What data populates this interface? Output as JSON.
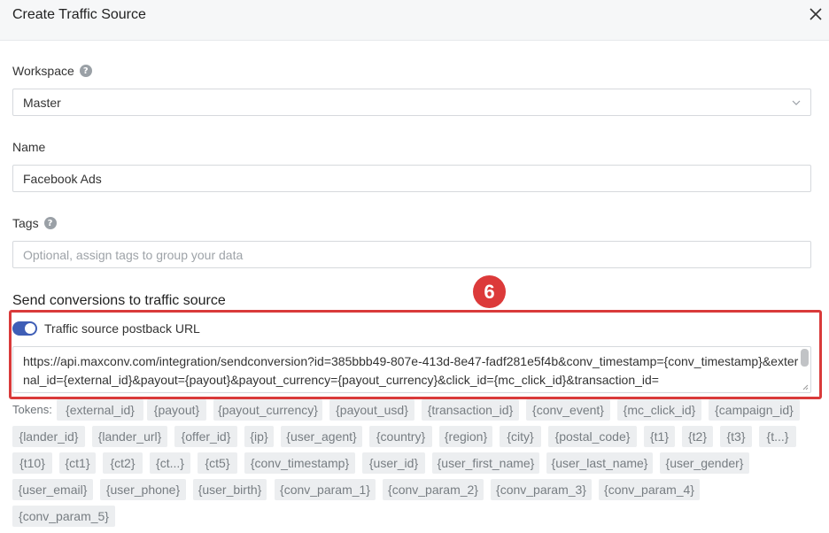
{
  "header": {
    "title": "Create Traffic Source"
  },
  "workspace": {
    "label": "Workspace",
    "value": "Master"
  },
  "name": {
    "label": "Name",
    "value": "Facebook Ads"
  },
  "tags": {
    "label": "Tags",
    "placeholder": "Optional, assign tags to group your data"
  },
  "section": {
    "title": "Send conversions to traffic source"
  },
  "annotation": {
    "number": "6"
  },
  "postback": {
    "toggle_label": "Traffic source postback URL",
    "enabled": true,
    "url": "https://api.maxconv.com/integration/sendconversion?id=385bbb49-807e-413d-8e47-fadf281e5f4b&conv_timestamp={conv_timestamp}&external_id={external_id}&payout={payout}&payout_currency={payout_currency}&click_id={mc_click_id}&transaction_id="
  },
  "tokens": {
    "label": "Tokens:",
    "items": [
      "{external_id}",
      "{payout}",
      "{payout_currency}",
      "{payout_usd}",
      "{transaction_id}",
      "{conv_event}",
      "{mc_click_id}",
      "{campaign_id}",
      "{lander_id}",
      "{lander_url}",
      "{offer_id}",
      "{ip}",
      "{user_agent}",
      "{country}",
      "{region}",
      "{city}",
      "{postal_code}",
      "{t1}",
      "{t2}",
      "{t3}",
      "{t...}",
      "{t10}",
      "{ct1}",
      "{ct2}",
      "{ct...}",
      "{ct5}",
      "{conv_timestamp}",
      "{user_id}",
      "{user_first_name}",
      "{user_last_name}",
      "{user_gender}",
      "{user_email}",
      "{user_phone}",
      "{user_birth}",
      "{conv_param_1}",
      "{conv_param_2}",
      "{conv_param_3}",
      "{conv_param_4}",
      "{conv_param_5}"
    ]
  }
}
